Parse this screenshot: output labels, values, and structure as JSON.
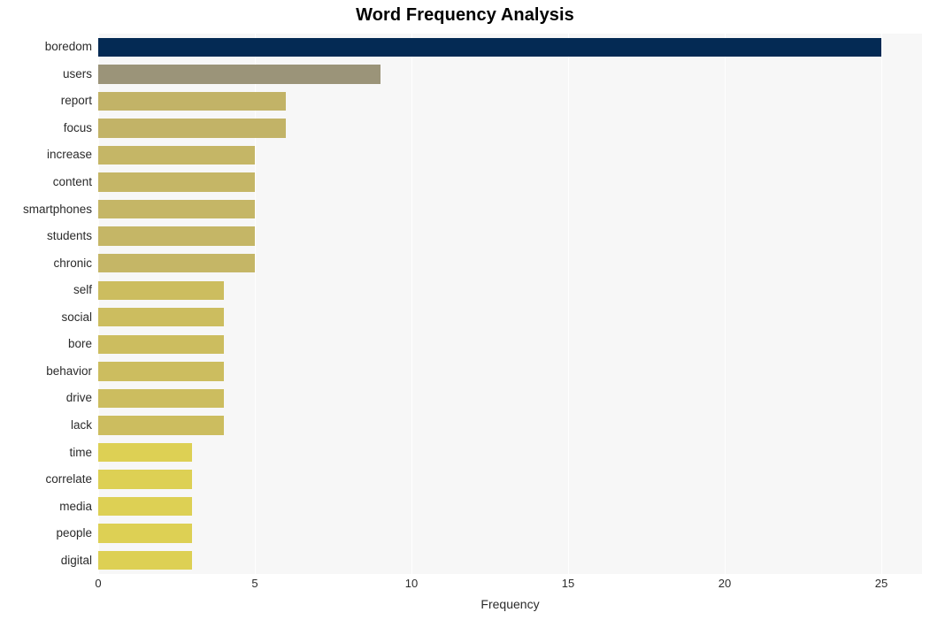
{
  "chart_data": {
    "type": "bar",
    "orientation": "horizontal",
    "title": "Word Frequency Analysis",
    "xlabel": "Frequency",
    "ylabel": "",
    "xlim": [
      0,
      26.3
    ],
    "xticks": [
      0,
      5,
      10,
      15,
      20,
      25
    ],
    "xtick_labels": [
      "0",
      "5",
      "10",
      "15",
      "20",
      "25"
    ],
    "grid": true,
    "grid_axis": "x",
    "legend": null,
    "categories": [
      "boredom",
      "users",
      "report",
      "focus",
      "increase",
      "content",
      "smartphones",
      "students",
      "chronic",
      "self",
      "social",
      "bore",
      "behavior",
      "drive",
      "lack",
      "time",
      "correlate",
      "media",
      "people",
      "digital"
    ],
    "values": [
      25,
      9,
      6,
      6,
      5,
      5,
      5,
      5,
      5,
      4,
      4,
      4,
      4,
      4,
      4,
      3,
      3,
      3,
      3,
      3
    ],
    "bar_colors": [
      "#042a54",
      "#9b9479",
      "#c2b367",
      "#c2b367",
      "#c5b666",
      "#c5b666",
      "#c5b666",
      "#c5b666",
      "#c5b666",
      "#ccbd5f",
      "#ccbd5f",
      "#ccbd5f",
      "#ccbd5f",
      "#ccbd5f",
      "#ccbd5f",
      "#ddd054",
      "#ddd054",
      "#ddd054",
      "#ddd054",
      "#ddd054"
    ],
    "plot_background": "#f7f7f7",
    "figure_background": "#ffffff",
    "gridline_color": "#ffffff",
    "text_color": "#2b2b2b",
    "title_color": "#000000"
  }
}
